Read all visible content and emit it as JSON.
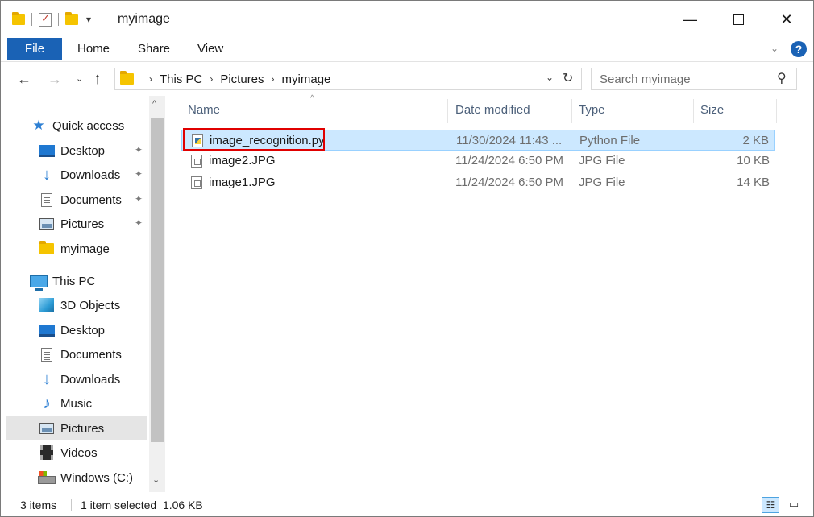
{
  "window": {
    "title": "myimage",
    "minimize": "—",
    "close": "✕"
  },
  "qat": {
    "dropdown": "▾"
  },
  "ribbon": {
    "file": "File",
    "home": "Home",
    "share": "Share",
    "view": "View",
    "collapse": "⌄",
    "help": "?"
  },
  "nav": {
    "back": "←",
    "forward": "→",
    "recent": "⌄",
    "up": "↑"
  },
  "address": {
    "crumbs": [
      "This PC",
      "Pictures",
      "myimage"
    ],
    "separator": "›",
    "dropdown": "⌄",
    "refresh": "↻"
  },
  "search": {
    "placeholder": "Search myimage",
    "icon": "⚲"
  },
  "sidebar": {
    "quick_access": "Quick access",
    "items": [
      {
        "label": "Desktop",
        "pinned": true
      },
      {
        "label": "Downloads",
        "pinned": true
      },
      {
        "label": "Documents",
        "pinned": true
      },
      {
        "label": "Pictures",
        "pinned": true
      },
      {
        "label": "myimage",
        "pinned": false
      }
    ],
    "this_pc": "This PC",
    "pc_items": [
      {
        "label": "3D Objects"
      },
      {
        "label": "Desktop"
      },
      {
        "label": "Documents"
      },
      {
        "label": "Downloads"
      },
      {
        "label": "Music"
      },
      {
        "label": "Pictures"
      },
      {
        "label": "Videos"
      },
      {
        "label": "Windows (C:)"
      }
    ],
    "pin_glyph": "✦",
    "scroll_up": "^",
    "scroll_down": "⌄"
  },
  "columns": {
    "name": "Name",
    "date": "Date modified",
    "type": "Type",
    "size": "Size",
    "sort_glyph": "^"
  },
  "files": [
    {
      "name": "image_recognition.py",
      "date": "11/30/2024 11:43 ...",
      "type": "Python File",
      "size": "2 KB",
      "selected": true
    },
    {
      "name": "image2.JPG",
      "date": "11/24/2024 6:50 PM",
      "type": "JPG File",
      "size": "10 KB",
      "selected": false
    },
    {
      "name": "image1.JPG",
      "date": "11/24/2024 6:50 PM",
      "type": "JPG File",
      "size": "14 KB",
      "selected": false
    }
  ],
  "status": {
    "count": "3 items",
    "selected": "1 item selected  1.06 KB"
  },
  "colors": {
    "accent": "#1a62b5",
    "selection": "#cce8ff",
    "highlight_box": "#e00000"
  }
}
